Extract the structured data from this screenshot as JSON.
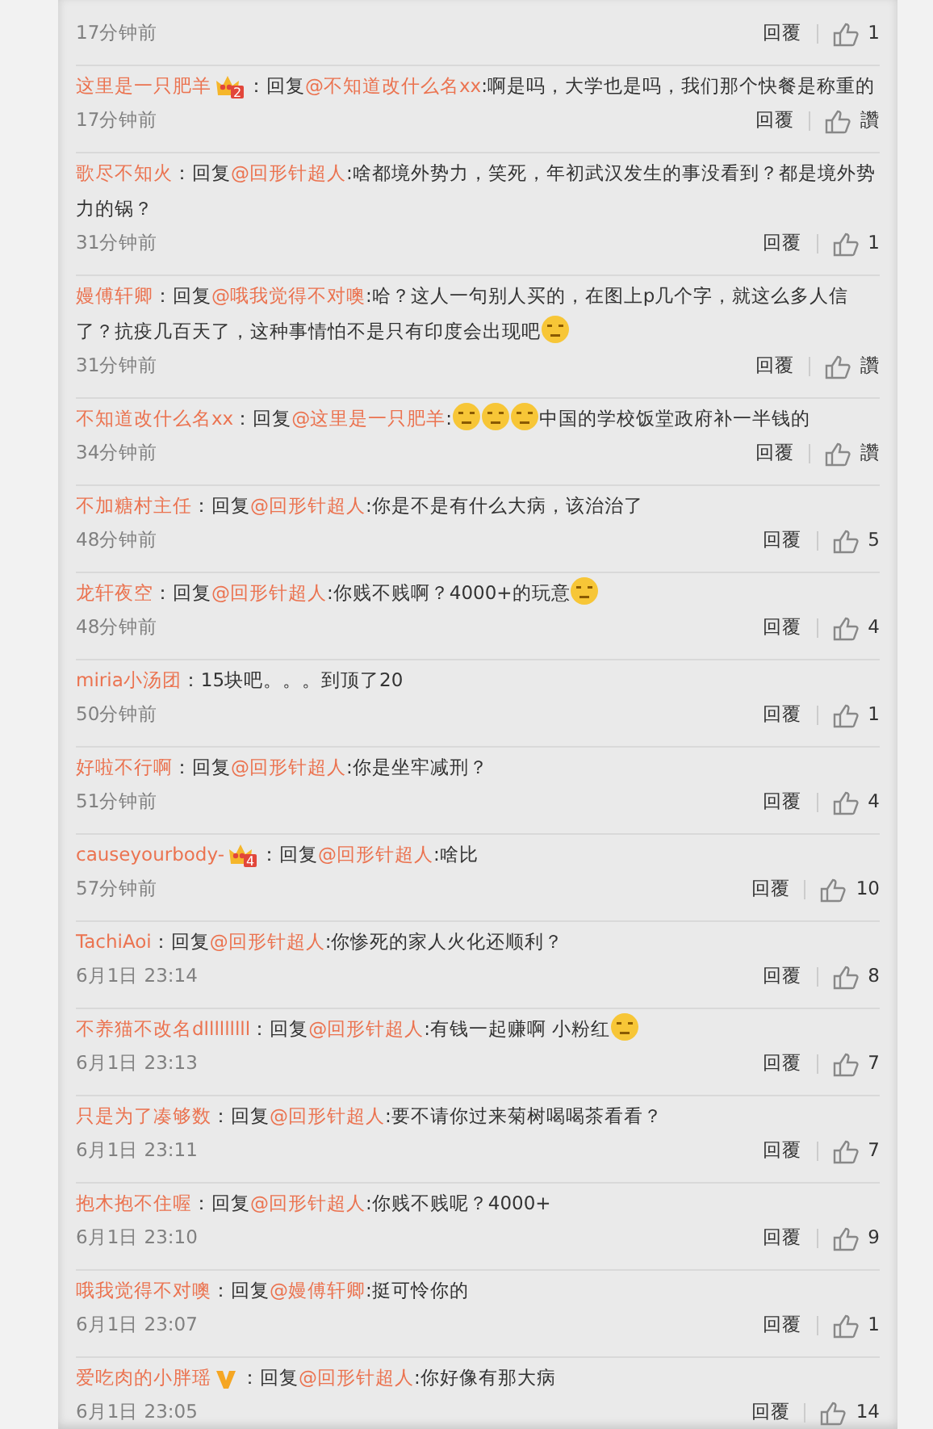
{
  "comments": [
    {
      "time": "17分钟前",
      "reply_button": "回覆",
      "likes": "1"
    },
    {
      "author": "这里是一只肥羊",
      "badge": {
        "kind": "crown",
        "text": "2"
      },
      "body": [
        {
          "kind": "text",
          "text": "：回复"
        },
        {
          "kind": "mention",
          "text": "@不知道改什么名xx"
        },
        {
          "kind": "text",
          "text": ":啊是吗，大学也是吗，我们那个快餐是称重的"
        }
      ],
      "time": "17分钟前",
      "reply_button": "回覆",
      "likes": "讚"
    },
    {
      "author": "歌尽不知火",
      "body": [
        {
          "kind": "text",
          "text": "：回复"
        },
        {
          "kind": "mention",
          "text": "@回形针超人"
        },
        {
          "kind": "text",
          "text": ":啥都境外势力，笑死，年初武汉发生的事没看到？都是境外势力的锅？"
        }
      ],
      "time": "31分钟前",
      "reply_button": "回覆",
      "likes": "1"
    },
    {
      "author": "嫚傅轩卿",
      "body": [
        {
          "kind": "text",
          "text": "：回复"
        },
        {
          "kind": "mention",
          "text": "@哦我觉得不对噢"
        },
        {
          "kind": "text",
          "text": ":哈？这人一句别人买的，在图上p几个字，就这么多人信了？抗疫几百天了，这种事情怕不是只有印度会出现吧"
        },
        {
          "kind": "emoji"
        }
      ],
      "time": "31分钟前",
      "reply_button": "回覆",
      "likes": "讚"
    },
    {
      "author": "不知道改什么名xx",
      "body": [
        {
          "kind": "text",
          "text": "：回复"
        },
        {
          "kind": "mention",
          "text": "@这里是一只肥羊"
        },
        {
          "kind": "text",
          "text": ":"
        },
        {
          "kind": "emoji"
        },
        {
          "kind": "emoji"
        },
        {
          "kind": "emoji"
        },
        {
          "kind": "text",
          "text": "中国的学校饭堂政府补一半钱的"
        }
      ],
      "time": "34分钟前",
      "reply_button": "回覆",
      "likes": "讚"
    },
    {
      "author": "不加糖村主任",
      "body": [
        {
          "kind": "text",
          "text": "：回复"
        },
        {
          "kind": "mention",
          "text": "@回形针超人"
        },
        {
          "kind": "text",
          "text": ":你是不是有什么大病，该治治了"
        }
      ],
      "time": "48分钟前",
      "reply_button": "回覆",
      "likes": "5"
    },
    {
      "author": "龙轩夜空",
      "body": [
        {
          "kind": "text",
          "text": "：回复"
        },
        {
          "kind": "mention",
          "text": "@回形针超人"
        },
        {
          "kind": "text",
          "text": ":你贱不贱啊？4000+的玩意"
        },
        {
          "kind": "emoji"
        }
      ],
      "time": "48分钟前",
      "reply_button": "回覆",
      "likes": "4"
    },
    {
      "author": "miria小汤团",
      "body": [
        {
          "kind": "text",
          "text": "：15块吧。。。到顶了20"
        }
      ],
      "time": "50分钟前",
      "reply_button": "回覆",
      "likes": "1"
    },
    {
      "author": "好啦不行啊",
      "body": [
        {
          "kind": "text",
          "text": "：回复"
        },
        {
          "kind": "mention",
          "text": "@回形针超人"
        },
        {
          "kind": "text",
          "text": ":你是坐牢减刑？"
        }
      ],
      "time": "51分钟前",
      "reply_button": "回覆",
      "likes": "4"
    },
    {
      "author": "causeyourbody-",
      "badge": {
        "kind": "crown",
        "text": "4"
      },
      "body": [
        {
          "kind": "text",
          "text": "：回复"
        },
        {
          "kind": "mention",
          "text": "@回形针超人"
        },
        {
          "kind": "text",
          "text": ":啥比"
        }
      ],
      "time": "57分钟前",
      "reply_button": "回覆",
      "likes": "10"
    },
    {
      "author": "TachiAoi",
      "body": [
        {
          "kind": "text",
          "text": "：回复"
        },
        {
          "kind": "mention",
          "text": "@回形针超人"
        },
        {
          "kind": "text",
          "text": ":你惨死的家人火化还顺利？"
        }
      ],
      "time": "6月1日 23:14",
      "reply_button": "回覆",
      "likes": "8"
    },
    {
      "author": "不养猫不改名dlllllllll",
      "body": [
        {
          "kind": "text",
          "text": "：回复"
        },
        {
          "kind": "mention",
          "text": "@回形针超人"
        },
        {
          "kind": "text",
          "text": ":有钱一起赚啊 小粉红"
        },
        {
          "kind": "emoji"
        }
      ],
      "time": "6月1日 23:13",
      "reply_button": "回覆",
      "likes": "7"
    },
    {
      "author": "只是为了凑够数",
      "body": [
        {
          "kind": "text",
          "text": "：回复"
        },
        {
          "kind": "mention",
          "text": "@回形针超人"
        },
        {
          "kind": "text",
          "text": ":要不请你过来菊树喝喝茶看看？"
        }
      ],
      "time": "6月1日 23:11",
      "reply_button": "回覆",
      "likes": "7"
    },
    {
      "author": "抱木抱不住喔",
      "body": [
        {
          "kind": "text",
          "text": "：回复"
        },
        {
          "kind": "mention",
          "text": "@回形针超人"
        },
        {
          "kind": "text",
          "text": ":你贱不贱呢？4000+"
        }
      ],
      "time": "6月1日 23:10",
      "reply_button": "回覆",
      "likes": "9"
    },
    {
      "author": "哦我觉得不对噢",
      "body": [
        {
          "kind": "text",
          "text": "：回复"
        },
        {
          "kind": "mention",
          "text": "@嫚傅轩卿"
        },
        {
          "kind": "text",
          "text": ":挺可怜你的"
        }
      ],
      "time": "6月1日 23:07",
      "reply_button": "回覆",
      "likes": "1"
    },
    {
      "author": "爱吃肉的小胖瑶",
      "badge": {
        "kind": "vip"
      },
      "body": [
        {
          "kind": "text",
          "text": "：回复"
        },
        {
          "kind": "mention",
          "text": "@回形针超人"
        },
        {
          "kind": "text",
          "text": ":你好像有那大病"
        }
      ],
      "time": "6月1日 23:05",
      "reply_button": "回覆",
      "likes": "14"
    }
  ]
}
